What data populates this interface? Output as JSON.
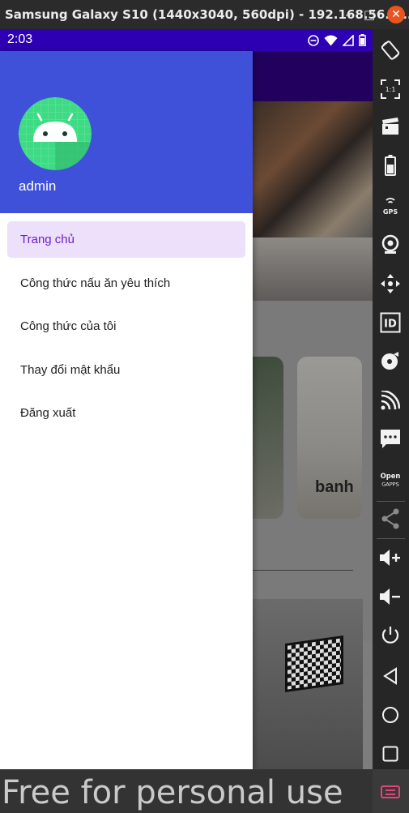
{
  "window": {
    "title": "Samsung Galaxy S10 (1440x3040, 560dpi) - 192.168.56.1...",
    "minimize_glyph": "–",
    "maximize_glyph": "□",
    "close_glyph": "✕"
  },
  "status_bar": {
    "time": "2:03",
    "icons": [
      "do-not-disturb-icon",
      "wifi-icon",
      "signal-icon",
      "battery-icon"
    ]
  },
  "drawer": {
    "username": "admin",
    "menu": [
      {
        "label": "Trang chủ",
        "active": true
      },
      {
        "label": "Công thức nấu ăn yêu thích",
        "active": false
      },
      {
        "label": "Công thức của tôi",
        "active": false
      },
      {
        "label": "Thay đổi mật khẩu",
        "active": false
      },
      {
        "label": "Đăng xuất",
        "active": false
      }
    ]
  },
  "background_content": {
    "card_label": "banh"
  },
  "side_panel": {
    "tools": [
      "rotate-icon",
      "pixel-perfect-icon",
      "screen-record-icon",
      "battery-icon",
      "gps-icon",
      "camera-icon",
      "remote-control-icon",
      "identifiers-icon",
      "disk-icon",
      "cast-icon",
      "sms-icon",
      "opengapps-icon",
      "share-icon",
      "volume-up-icon",
      "volume-down-icon",
      "power-icon",
      "back-icon",
      "home-icon",
      "recents-icon",
      "menu-icon"
    ],
    "gps_label": "GPS",
    "id_label": "ID",
    "opengapps_label": "Open\nGAPPS",
    "pixel_label": "1:1"
  },
  "watermark": "Free for personal use",
  "colors": {
    "status_bar": "#2d00b3",
    "drawer_header": "#3f51d8",
    "active_item_bg": "#ece0fb",
    "active_item_text": "#6a1fd0"
  }
}
